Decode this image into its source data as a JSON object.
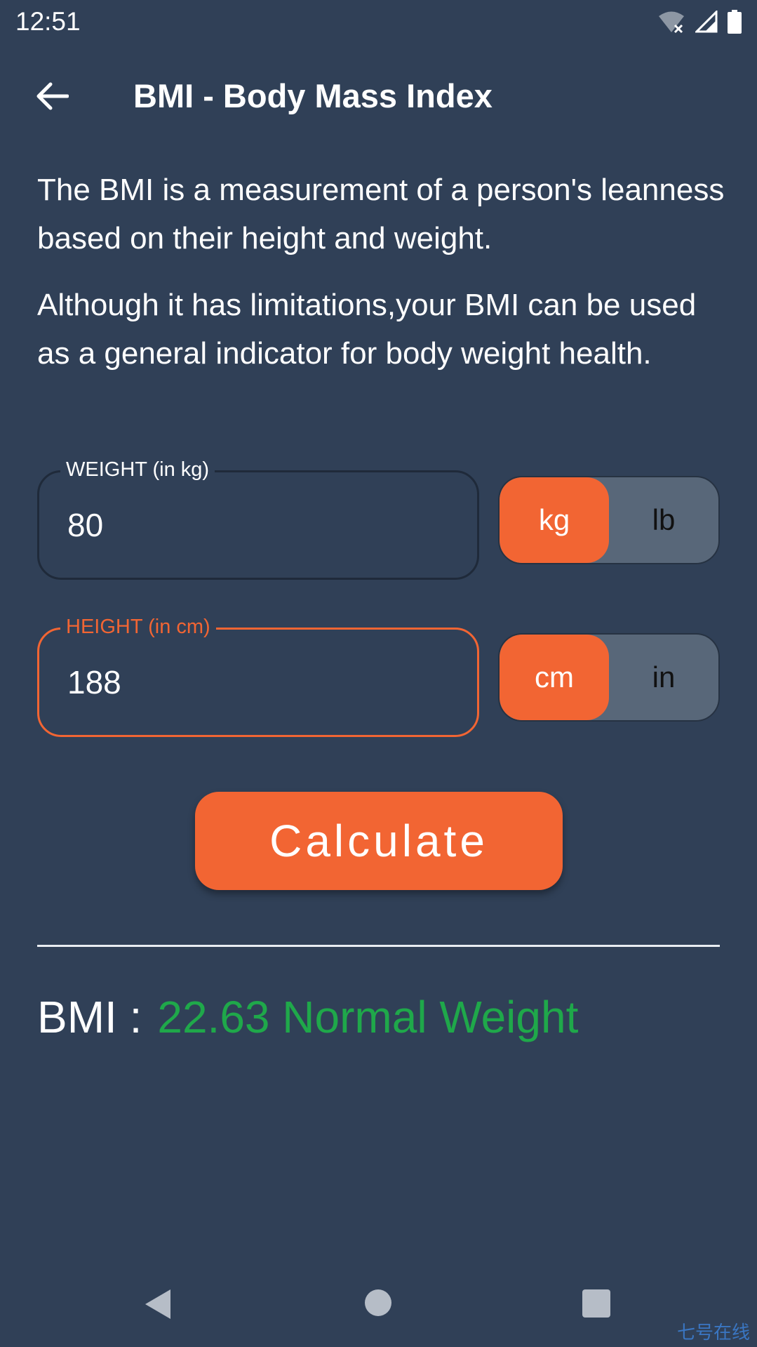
{
  "status_bar": {
    "time": "12:51",
    "icons": [
      "wifi-off-icon",
      "signal-icon",
      "battery-icon"
    ]
  },
  "app_bar": {
    "back_icon": "arrow-back-icon",
    "title": "BMI - Body Mass Index"
  },
  "description": {
    "paragraph1": "The BMI is a measurement of a person's leanness based on their height and weight.",
    "paragraph2": "Although it has limitations,your BMI can be used as a general indicator for body weight health."
  },
  "weight_field": {
    "label": "WEIGHT (in kg)",
    "value": "80",
    "units": [
      "kg",
      "lb"
    ],
    "selected_unit": "kg"
  },
  "height_field": {
    "label": "HEIGHT (in cm)",
    "value": "188",
    "units": [
      "cm",
      "in"
    ],
    "selected_unit": "cm"
  },
  "calculate_button": {
    "label": "Calculate"
  },
  "result": {
    "label": "BMI :",
    "value": "22.63 Normal Weight",
    "value_color": "#1fa84a"
  },
  "nav_bar": {
    "icons": [
      "nav-back-icon",
      "nav-home-icon",
      "nav-recents-icon"
    ]
  },
  "watermark": "七号在线",
  "colors": {
    "background": "#304057",
    "accent": "#f26533",
    "toggle_inactive": "#586779",
    "success": "#1fa84a"
  }
}
